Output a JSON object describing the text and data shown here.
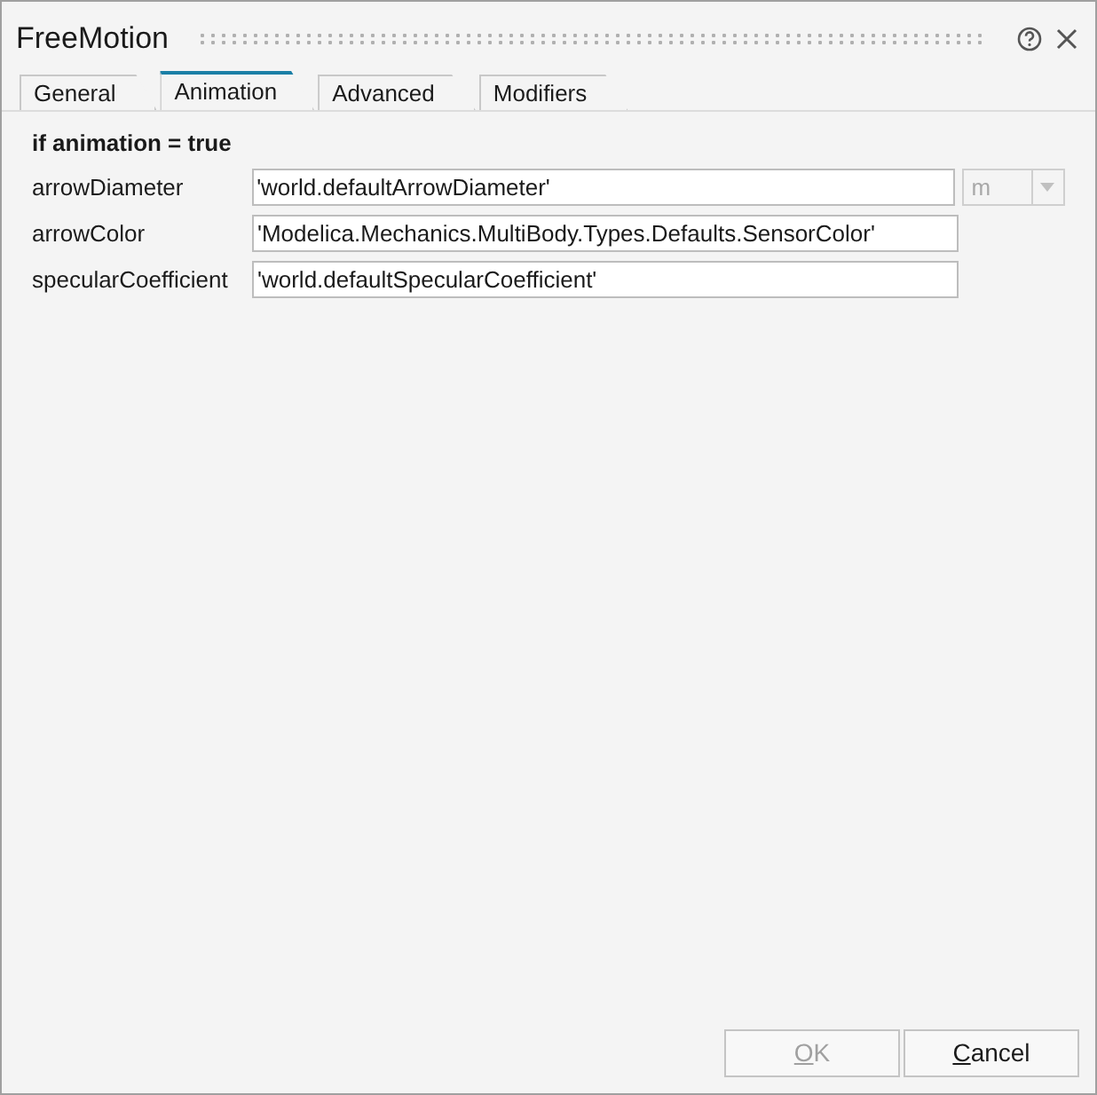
{
  "window": {
    "title": "FreeMotion"
  },
  "tabs": [
    {
      "label": "General",
      "selected": false
    },
    {
      "label": "Animation",
      "selected": true
    },
    {
      "label": "Advanced",
      "selected": false
    },
    {
      "label": "Modifiers",
      "selected": false
    }
  ],
  "section": {
    "title": "if animation = true"
  },
  "parameters": [
    {
      "name": "arrowDiameter",
      "value": "'world.defaultArrowDiameter'",
      "unit": {
        "value": "m",
        "disabled": true
      }
    },
    {
      "name": "arrowColor",
      "value": "'Modelica.Mechanics.MultiBody.Types.Defaults.SensorColor'"
    },
    {
      "name": "specularCoefficient",
      "value": "'world.defaultSpecularCoefficient'"
    }
  ],
  "buttons": [
    {
      "label": "OK",
      "disabled": true,
      "mnemonic_first": true
    },
    {
      "label": "Cancel",
      "disabled": false,
      "mnemonic_first": true
    }
  ]
}
